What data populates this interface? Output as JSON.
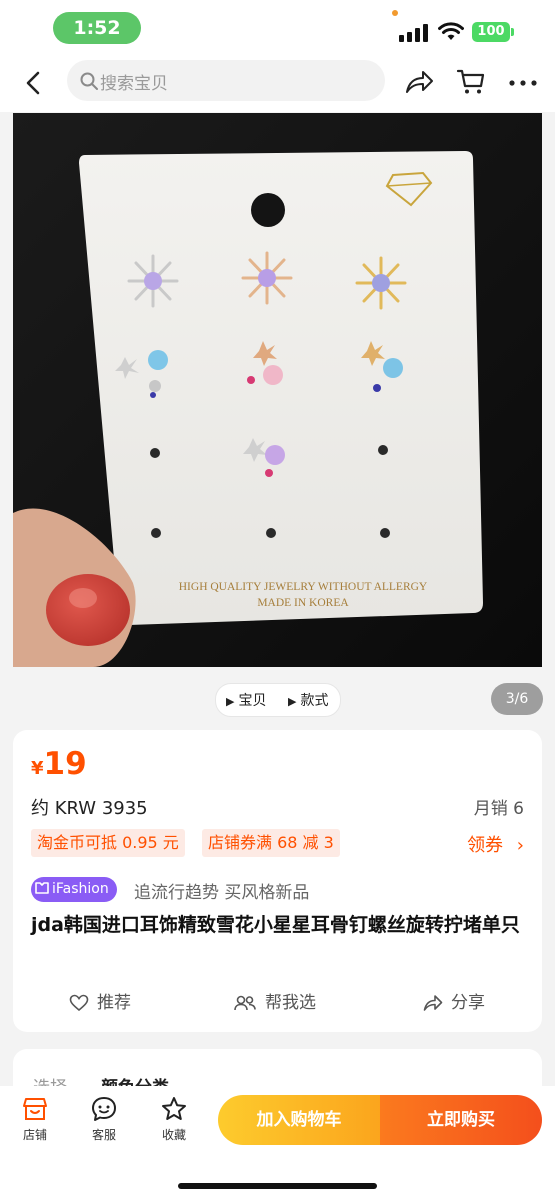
{
  "status_bar": {
    "time": "1:52",
    "battery": "100"
  },
  "nav": {
    "search_placeholder": "搜索宝贝"
  },
  "gallery": {
    "card_text_line1": "HIGH QUALITY JEWELRY WITHOUT ALLERGY",
    "card_text_line2": "MADE IN KOREA",
    "tabs": [
      "宝贝",
      "款式"
    ],
    "page_counter": "3/6"
  },
  "product": {
    "currency": "¥",
    "price": "19",
    "krw_price": "约 KRW 3935",
    "monthly_sales": "月销 6",
    "coupons": [
      "淘金币可抵 0.95 元",
      "店铺券满 68 减 3"
    ],
    "claim_label": "领券",
    "badge": "iFashion",
    "slogan": "追流行趋势 买风格新品",
    "title": "jda韩国进口耳饰精致雪花小星星耳骨钉螺丝旋转拧堵单只",
    "actions": [
      "推荐",
      "帮我选",
      "分享"
    ]
  },
  "next_section": {
    "label": "选择",
    "value": "颜色分类"
  },
  "bottom_bar": {
    "items": [
      "店铺",
      "客服",
      "收藏"
    ],
    "add_to_cart": "加入购物车",
    "buy_now": "立即购买"
  },
  "colors": {
    "accent": "#ff5000",
    "cart_gradient": [
      "#fdcb2d",
      "#fba51d"
    ],
    "buy_gradient": [
      "#fb7a1e",
      "#f44f1c"
    ],
    "ifashion": "#8a5cf5",
    "time_pill": "#5cc668",
    "battery": "#4cd964"
  }
}
